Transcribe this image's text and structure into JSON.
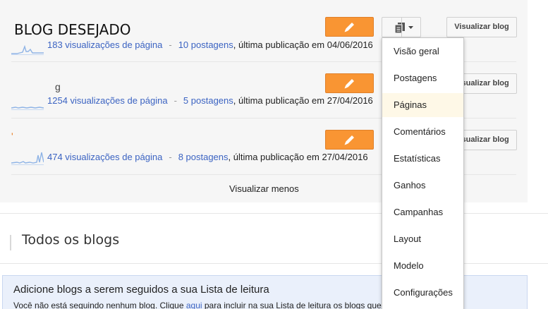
{
  "blogs": [
    {
      "title": "BLOG DESEJADO",
      "pageviews": "183 visualizações de página",
      "posts": "10 postagens",
      "last_post": ", última publicação em 04/06/2016",
      "separator": "-",
      "view_label": "Visualizar blog"
    },
    {
      "title_fragment": "g",
      "pageviews": "1254 visualizações de página",
      "posts": "5 postagens",
      "last_post": ", última publicação em 27/04/2016",
      "separator": "-",
      "view_label": "Visualizar blog"
    },
    {
      "title_fragment": "'",
      "pageviews": "474 visualizações de página",
      "posts": "8 postagens",
      "last_post": ", última publicação em 27/04/2016",
      "separator": "-",
      "view_label": "Visualizar blog"
    }
  ],
  "view_less": "Visualizar menos",
  "all_blogs": {
    "title": "Todos os blogs"
  },
  "reading_list": {
    "heading": "Adicione blogs a serem seguidos a sua Lista de leitura",
    "text_before": "Você não está seguindo nenhum blog. Clique ",
    "link": "aqui",
    "text_after": " para incluir na sua Lista de leitura os blogs que você deseja seguir."
  },
  "dropdown": {
    "items": [
      "Visão geral",
      "Postagens",
      "Páginas",
      "Comentários",
      "Estatísticas",
      "Ganhos",
      "Campanhas",
      "Layout",
      "Modelo",
      "Configurações"
    ],
    "highlighted": "Páginas"
  },
  "icons": {
    "edit": "pencil-icon",
    "copy": "documents-icon",
    "menu": "caret-down-icon"
  },
  "colors": {
    "edit_button": "#f99533",
    "link": "#3b63c2",
    "sparkline": "#8fb4e6",
    "menu_highlight": "#fef8e7"
  }
}
